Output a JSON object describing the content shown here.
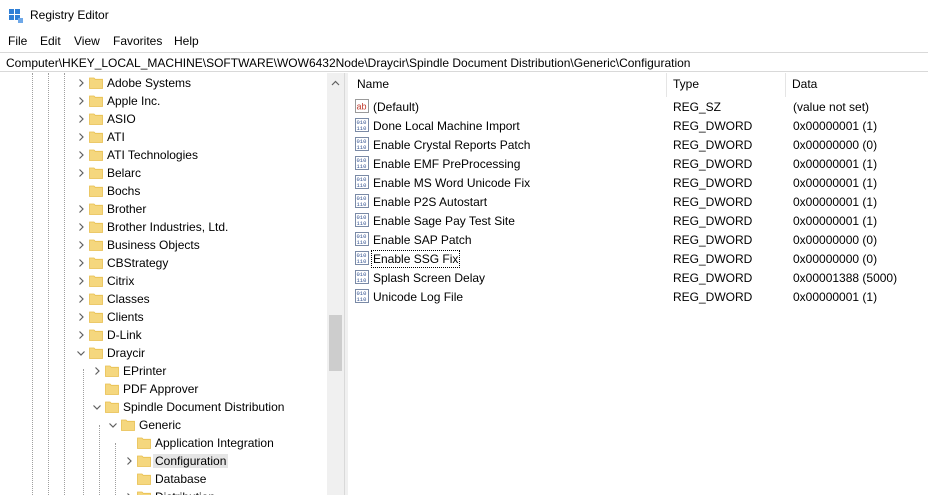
{
  "window": {
    "title": "Registry Editor"
  },
  "menu": [
    "File",
    "Edit",
    "View",
    "Favorites",
    "Help"
  ],
  "address": "Computer\\HKEY_LOCAL_MACHINE\\SOFTWARE\\WOW6432Node\\Draycir\\Spindle Document Distribution\\Generic\\Configuration",
  "tree": [
    {
      "label": "Adobe Systems",
      "level": 0,
      "expander": "collapsed"
    },
    {
      "label": "Apple Inc.",
      "level": 0,
      "expander": "collapsed"
    },
    {
      "label": "ASIO",
      "level": 0,
      "expander": "collapsed"
    },
    {
      "label": "ATI",
      "level": 0,
      "expander": "collapsed"
    },
    {
      "label": "ATI Technologies",
      "level": 0,
      "expander": "collapsed"
    },
    {
      "label": "Belarc",
      "level": 0,
      "expander": "collapsed"
    },
    {
      "label": "Bochs",
      "level": 0,
      "expander": "none"
    },
    {
      "label": "Brother",
      "level": 0,
      "expander": "collapsed"
    },
    {
      "label": "Brother Industries, Ltd.",
      "level": 0,
      "expander": "collapsed"
    },
    {
      "label": "Business Objects",
      "level": 0,
      "expander": "collapsed"
    },
    {
      "label": "CBStrategy",
      "level": 0,
      "expander": "collapsed"
    },
    {
      "label": "Citrix",
      "level": 0,
      "expander": "collapsed"
    },
    {
      "label": "Classes",
      "level": 0,
      "expander": "collapsed"
    },
    {
      "label": "Clients",
      "level": 0,
      "expander": "collapsed"
    },
    {
      "label": "D-Link",
      "level": 0,
      "expander": "collapsed"
    },
    {
      "label": "Draycir",
      "level": 0,
      "expander": "expanded"
    },
    {
      "label": "EPrinter",
      "level": 1,
      "expander": "collapsed"
    },
    {
      "label": "PDF Approver",
      "level": 1,
      "expander": "none"
    },
    {
      "label": "Spindle Document Distribution",
      "level": 1,
      "expander": "expanded"
    },
    {
      "label": "Generic",
      "level": 2,
      "expander": "expanded"
    },
    {
      "label": "Application Integration",
      "level": 3,
      "expander": "none"
    },
    {
      "label": "Configuration",
      "level": 3,
      "expander": "collapsed",
      "selected": true
    },
    {
      "label": "Database",
      "level": 3,
      "expander": "none"
    },
    {
      "label": "Distribution",
      "level": 3,
      "expander": "collapsed"
    }
  ],
  "columns": {
    "name": "Name",
    "type": "Type",
    "data": "Data"
  },
  "values": [
    {
      "name": "(Default)",
      "type": "REG_SZ",
      "data": "(value not set)",
      "icon": "string-value-icon"
    },
    {
      "name": "Done Local Machine Import",
      "type": "REG_DWORD",
      "data": "0x00000001 (1)",
      "icon": "binary-value-icon"
    },
    {
      "name": "Enable Crystal Reports Patch",
      "type": "REG_DWORD",
      "data": "0x00000000 (0)",
      "icon": "binary-value-icon"
    },
    {
      "name": "Enable EMF PreProcessing",
      "type": "REG_DWORD",
      "data": "0x00000001 (1)",
      "icon": "binary-value-icon"
    },
    {
      "name": "Enable MS Word Unicode Fix",
      "type": "REG_DWORD",
      "data": "0x00000001 (1)",
      "icon": "binary-value-icon"
    },
    {
      "name": "Enable P2S Autostart",
      "type": "REG_DWORD",
      "data": "0x00000001 (1)",
      "icon": "binary-value-icon"
    },
    {
      "name": "Enable Sage Pay Test Site",
      "type": "REG_DWORD",
      "data": "0x00000001 (1)",
      "icon": "binary-value-icon"
    },
    {
      "name": "Enable SAP Patch",
      "type": "REG_DWORD",
      "data": "0x00000000 (0)",
      "icon": "binary-value-icon"
    },
    {
      "name": "Enable SSG Fix",
      "type": "REG_DWORD",
      "data": "0x00000000 (0)",
      "icon": "binary-value-icon",
      "focused": true
    },
    {
      "name": "Splash Screen Delay",
      "type": "REG_DWORD",
      "data": "0x00001388 (5000)",
      "icon": "binary-value-icon"
    },
    {
      "name": "Unicode Log File",
      "type": "REG_DWORD",
      "data": "0x00000001 (1)",
      "icon": "binary-value-icon"
    }
  ],
  "colors": {
    "folder": "#f5d77e",
    "folder_dark": "#e8bf4f",
    "selection": "#e5e5e5",
    "app_icon": "#2f7fd6"
  }
}
